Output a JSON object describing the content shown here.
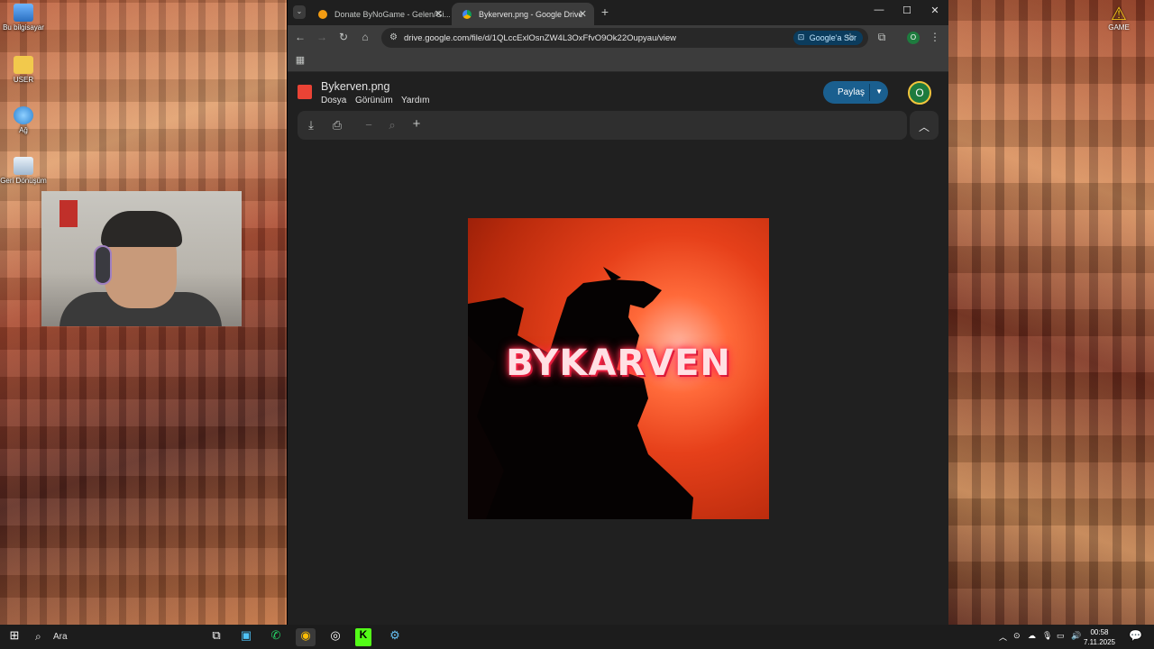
{
  "desktop": {
    "icons": [
      {
        "label": "Bu bilgisayar"
      },
      {
        "label": "USER"
      },
      {
        "label": "Ağ"
      },
      {
        "label": "Geri Dönüşüm"
      }
    ],
    "game_icon_label": "GAME"
  },
  "browser": {
    "tabs": [
      {
        "title": "Donate ByNoGame - Gelen/Gi...",
        "active": false
      },
      {
        "title": "Bykerven.png - Google Drive",
        "active": true
      }
    ],
    "new_tab": "+",
    "url": "drive.google.com/file/d/1QLccExlOsnZW4L3OxFfvO9Ok22Oupyau/view",
    "ask_google": "Google'a Sor",
    "profile_initial": "O"
  },
  "drive": {
    "file_title": "Bykerven.png",
    "menu": [
      "Dosya",
      "Görünüm",
      "Yardım"
    ],
    "share_label": "Paylaş",
    "avatar_initial": "O",
    "preview_text": "BYKARVEN"
  },
  "taskbar": {
    "search_label": "Ara",
    "time": "00:58",
    "date": "7.11.2025"
  },
  "colors": {
    "browser_bg": "#1f1f1f",
    "share_button": "#1a5f8f",
    "avatar_bg": "#1e7b3e"
  }
}
